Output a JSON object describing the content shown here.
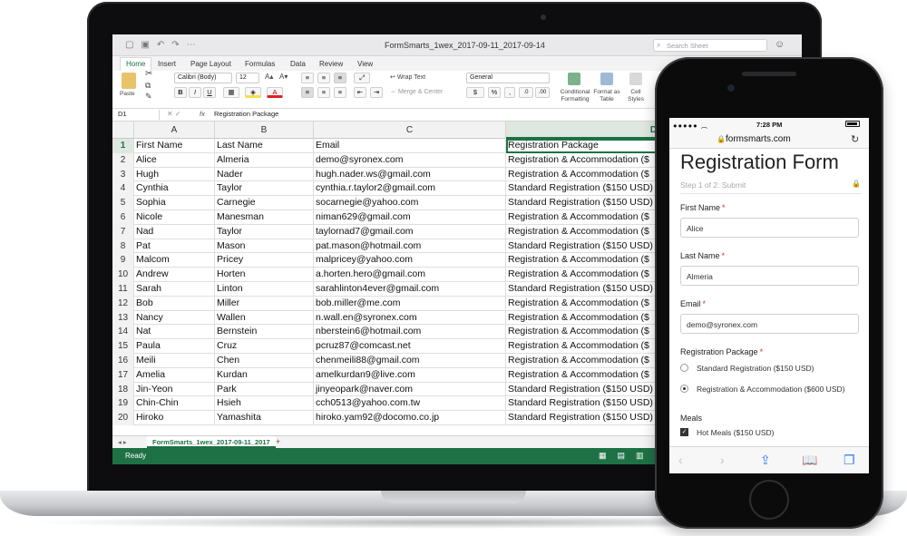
{
  "excel": {
    "doc_title": "FormSmarts_1wex_2017-09-11_2017-09-14",
    "search_placeholder": "Search Sheet",
    "tabs": [
      "Home",
      "Insert",
      "Page Layout",
      "Formulas",
      "Data",
      "Review",
      "View"
    ],
    "ribbon": {
      "paste": "Paste",
      "font_name": "Calibri (Body)",
      "font_size": "12",
      "wrap_text": "Wrap Text",
      "merge_center": "Merge & Center",
      "number_format": "General",
      "conditional_formatting": "Conditional Formatting",
      "format_as_table": "Format as Table",
      "cell_styles": "Cell Styles",
      "bold": "B",
      "italic": "I",
      "underline": "U"
    },
    "name_box": "D1",
    "formula_value": "Registration Package",
    "columns": [
      "A",
      "B",
      "C",
      "D"
    ],
    "rows": [
      [
        "1",
        "First Name",
        "Last Name",
        "Email",
        "Registration Package"
      ],
      [
        "2",
        "Alice",
        "Almeria",
        "demo@syronex.com",
        "Registration & Accommodation ($"
      ],
      [
        "3",
        "Hugh",
        "Nader",
        "hugh.nader.ws@gmail.com",
        "Registration & Accommodation ($"
      ],
      [
        "4",
        "Cynthia",
        "Taylor",
        "cynthia.r.taylor2@gmail.com",
        "Standard Registration ($150 USD)"
      ],
      [
        "5",
        "Sophia",
        "Carnegie",
        "socarnegie@yahoo.com",
        "Standard Registration ($150 USD)"
      ],
      [
        "6",
        "Nicole",
        "Manesman",
        "niman629@gmail.com",
        "Registration & Accommodation ($"
      ],
      [
        "7",
        "Nad",
        "Taylor",
        "taylornad7@gmail.com",
        "Registration & Accommodation ($"
      ],
      [
        "8",
        "Pat",
        "Mason",
        "pat.mason@hotmail.com",
        "Standard Registration ($150 USD)"
      ],
      [
        "9",
        "Malcom",
        "Pricey",
        "malpricey@yahoo.com",
        "Registration & Accommodation ($"
      ],
      [
        "10",
        "Andrew",
        "Horten",
        "a.horten.hero@gmail.com",
        "Registration & Accommodation ($"
      ],
      [
        "11",
        "Sarah",
        "Linton",
        "sarahlinton4ever@gmail.com",
        "Standard Registration ($150 USD)"
      ],
      [
        "12",
        "Bob",
        "Miller",
        "bob.miller@me.com",
        "Registration & Accommodation ($"
      ],
      [
        "13",
        "Nancy",
        "Wallen",
        "n.wall.en@syronex.com",
        "Registration & Accommodation ($"
      ],
      [
        "14",
        "Nat",
        "Bernstein",
        "nberstein6@hotmail.com",
        "Registration & Accommodation ($"
      ],
      [
        "15",
        "Paula",
        "Cruz",
        "pcruz87@comcast.net",
        "Registration & Accommodation ($"
      ],
      [
        "16",
        "Meili",
        "Chen",
        "chenmeili88@gmail.com",
        "Registration & Accommodation ($"
      ],
      [
        "17",
        "Amelia",
        "Kurdan",
        "amelkurdan9@live.com",
        "Registration & Accommodation ($"
      ],
      [
        "18",
        "Jin-Yeon",
        "Park",
        "jinyeopark@naver.com",
        "Standard Registration ($150 USD)"
      ],
      [
        "19",
        "Chin-Chin",
        "Hsieh",
        "cch0513@yahoo.com.tw",
        "Standard Registration ($150 USD)"
      ],
      [
        "20",
        "Hiroko",
        "Yamashita",
        "hiroko.yam92@docomo.co.jp",
        "Standard Registration ($150 USD)"
      ]
    ],
    "sheet_tab": "FormSmarts_1wex_2017-09-11_2017",
    "add_sheet": "+",
    "status": "Ready",
    "accent_color": "#1e7145"
  },
  "phone": {
    "time": "7:28 PM",
    "url": "formsmarts.com",
    "form_title": "Registration Form",
    "step": "Step 1 of 2: Submit",
    "required_mark": "*",
    "fields": {
      "first_name_label": "First Name",
      "first_name_value": "Alice",
      "last_name_label": "Last Name",
      "last_name_value": "Almeria",
      "email_label": "Email",
      "email_value": "demo@syronex.com",
      "package_label": "Registration Package",
      "package_options": [
        "Standard Registration ($150 USD)",
        "Registration & Accommodation ($600 USD)"
      ],
      "package_selected": "Registration & Accommodation ($600 USD)",
      "meals_label": "Meals",
      "meals_option": "Hot Meals ($150 USD)",
      "meals_checked": true
    },
    "toolbar_icons": [
      "back-icon",
      "forward-icon",
      "share-icon",
      "bookmarks-icon",
      "tabs-icon"
    ]
  }
}
